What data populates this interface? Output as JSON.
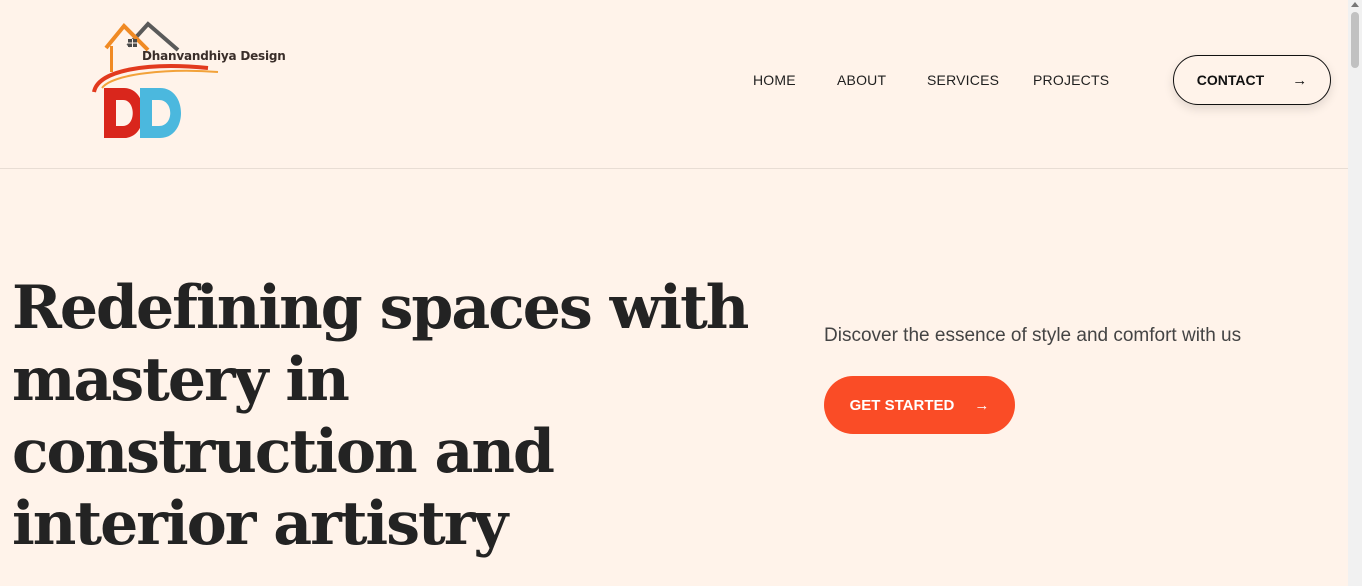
{
  "brand": {
    "name": "Dhanvandhiya Design",
    "logo_icon": "dd-house-logo"
  },
  "nav": {
    "items": [
      {
        "label": "HOME"
      },
      {
        "label": "ABOUT"
      },
      {
        "label": "SERVICES"
      },
      {
        "label": "PROJECTS"
      }
    ],
    "contact_label": "CONTACT",
    "contact_icon": "arrow-right-icon"
  },
  "hero": {
    "title": "Redefining spaces with mastery in construction and interior artistry",
    "subtitle": "Discover the essence of style and comfort with us",
    "cta_label": "GET STARTED",
    "cta_icon": "arrow-right-icon"
  },
  "colors": {
    "background": "#fff3ea",
    "accent": "#fa4c26",
    "text": "#232323"
  }
}
